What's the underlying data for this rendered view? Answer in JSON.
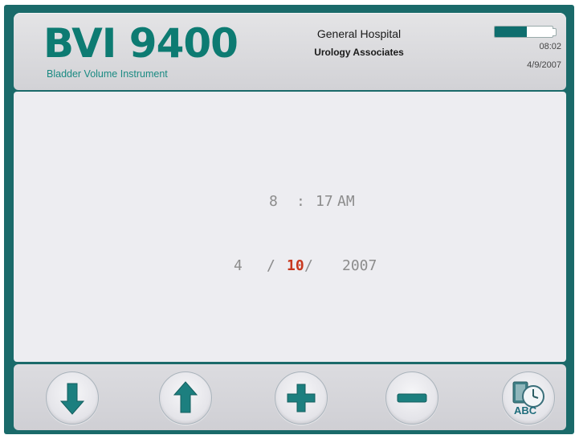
{
  "header": {
    "brand_title": "BVI 9400",
    "brand_subtitle": "Bladder Volume Instrument",
    "facility": "General Hospital",
    "practice": "Urology Associates",
    "clock": "08:02",
    "date": "4/9/2007",
    "battery_level_fraction": 0.55
  },
  "main": {
    "time": {
      "hour": "8",
      "separator": ":",
      "minute": "17",
      "ampm": "AM"
    },
    "date": {
      "month": "4",
      "sep1": "/",
      "day": "10",
      "sep2": "/",
      "year": "2007"
    }
  },
  "toolbar": {
    "buttons": [
      {
        "name": "down-arrow",
        "icon": "arrow-down-icon"
      },
      {
        "name": "up-arrow",
        "icon": "arrow-up-icon"
      },
      {
        "name": "plus",
        "icon": "plus-icon"
      },
      {
        "name": "minus",
        "icon": "minus-icon"
      },
      {
        "name": "clock-abc",
        "icon": "clock-abc-icon",
        "label": "ABC"
      }
    ]
  },
  "colors": {
    "frame": "#1a6a6a",
    "brand": "#0d7b72",
    "icon": "#1c7f7f",
    "active_field": "#c8381e",
    "field_text": "#8c8c8c"
  }
}
